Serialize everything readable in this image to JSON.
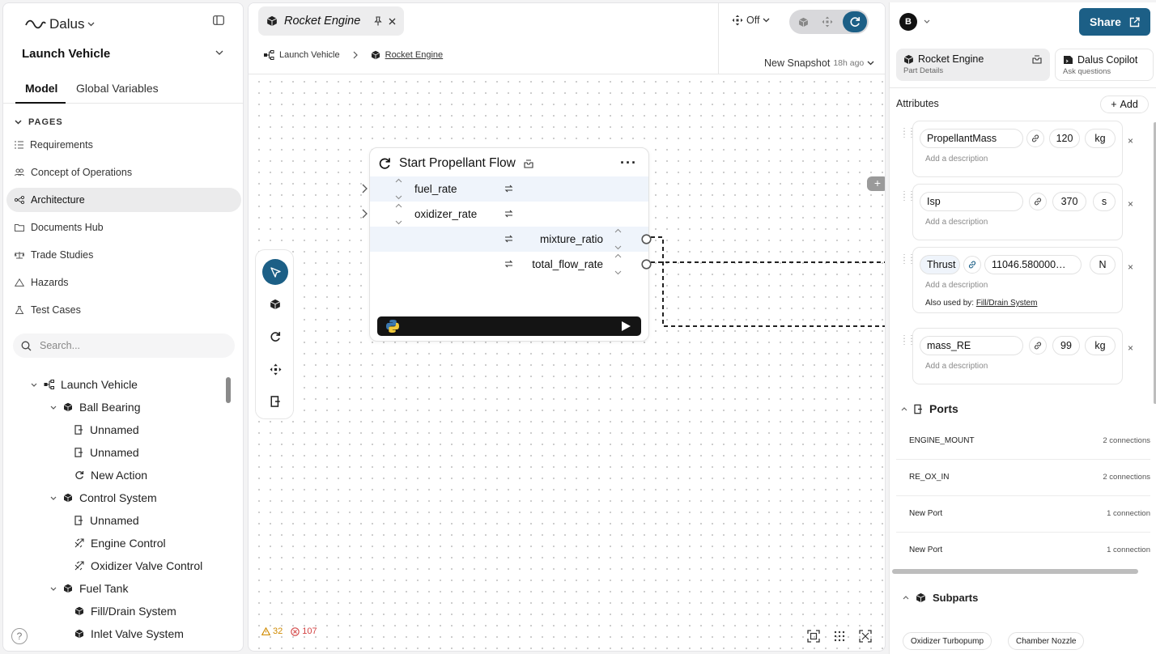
{
  "sidebar": {
    "brand": "Dalus",
    "project": "Launch Vehicle",
    "tabs": [
      "Model",
      "Global Variables"
    ],
    "pages_heading": "PAGES",
    "pages": [
      "Requirements",
      "Concept of Operations",
      "Architecture",
      "Documents Hub",
      "Trade Studies",
      "Hazards",
      "Test Cases"
    ],
    "active_page": "Architecture",
    "search_placeholder": "Search...",
    "tree": [
      {
        "label": "Launch Vehicle",
        "icon": "hierarchy-icon"
      },
      {
        "label": "Ball Bearing",
        "icon": "cube-icon"
      },
      {
        "label": "Unnamed",
        "icon": "door-icon"
      },
      {
        "label": "Unnamed",
        "icon": "door-icon"
      },
      {
        "label": "New Action",
        "icon": "action-icon"
      },
      {
        "label": "Control System",
        "icon": "cube-icon"
      },
      {
        "label": "Unnamed",
        "icon": "door-icon"
      },
      {
        "label": "Engine Control",
        "icon": "transition-icon"
      },
      {
        "label": "Oxidizer Valve Control",
        "icon": "transition-icon"
      },
      {
        "label": "Fuel Tank",
        "icon": "cube-icon"
      },
      {
        "label": "Fill/Drain System",
        "icon": "cube-icon"
      },
      {
        "label": "Inlet Valve System",
        "icon": "cube-icon"
      }
    ],
    "help": "?"
  },
  "center": {
    "file_tab": "Rocket Engine",
    "breadcrumb": [
      "Launch Vehicle",
      "Rocket Engine"
    ],
    "toggle_label": "Off",
    "snapshot_label": "New Snapshot",
    "snapshot_ago": "18h ago",
    "node": {
      "title": "Start Propellant Flow",
      "inputs": [
        "fuel_rate",
        "oxidizer_rate"
      ],
      "outputs": [
        "mixture_ratio",
        "total_flow_rate"
      ],
      "more": "···"
    },
    "add_port": "+",
    "warnings": "32",
    "errors": "107"
  },
  "right": {
    "avatar": "B",
    "share_label": "Share",
    "tabs": [
      {
        "title": "Rocket Engine",
        "subtitle": "Part Details"
      },
      {
        "title": "Dalus Copilot",
        "subtitle": "Ask questions"
      }
    ],
    "attributes_heading": "Attributes",
    "add_label": "Add",
    "description_placeholder": "Add a description",
    "attributes": [
      {
        "name": "PropellantMass",
        "value": "120",
        "unit": "kg"
      },
      {
        "name": "Isp",
        "value": "370",
        "unit": "s"
      },
      {
        "name": "Thrust",
        "value": "11046.580000…",
        "unit": "N",
        "also_used_label": "Also used by:",
        "also_used_link": "Fill/Drain System"
      },
      {
        "name": "mass_RE",
        "value": "99",
        "unit": "kg"
      }
    ],
    "ports_heading": "Ports",
    "ports": [
      {
        "name": "ENGINE_MOUNT",
        "connections": "2 connections"
      },
      {
        "name": "RE_OX_IN",
        "connections": "2 connections"
      },
      {
        "name": "New Port",
        "connections": "1 connection"
      },
      {
        "name": "New Port",
        "connections": "1 connection"
      }
    ],
    "subparts_heading": "Subparts",
    "subparts": [
      "Oxidizer Turbopump",
      "Chamber Nozzle"
    ]
  },
  "colors": {
    "accent": "#1c5f86",
    "warning": "#d08a00",
    "error": "#d24141"
  }
}
